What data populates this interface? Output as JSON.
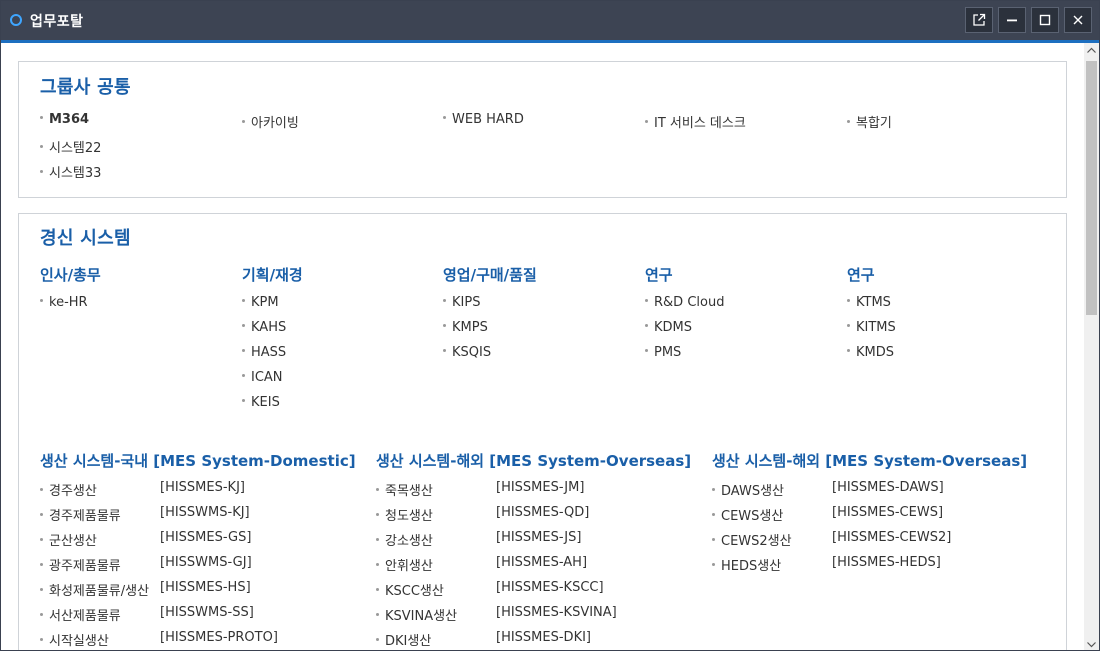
{
  "window": {
    "title": "업무포탈",
    "accent_color": "#1d6fc0",
    "titlebar_color": "#3d4453",
    "buttons": [
      "popout-icon",
      "minimize-icon",
      "maximize-icon",
      "close-icon"
    ]
  },
  "common": {
    "title": "그룹사 공통",
    "columns": [
      [
        "M364",
        "시스템22",
        "시스템33"
      ],
      [
        "아카이빙"
      ],
      [
        "WEB HARD"
      ],
      [
        "IT 서비스 데스크"
      ],
      [
        "복합기"
      ]
    ]
  },
  "mgmt": {
    "title": "경신 시스템",
    "groups": [
      {
        "heading": "인사/총무",
        "items": [
          "ke-HR"
        ]
      },
      {
        "heading": "기획/재경",
        "items": [
          "KPM",
          "KAHS",
          "HASS",
          "ICAN",
          "KEIS"
        ]
      },
      {
        "heading": "영업/구매/품질",
        "items": [
          "KIPS",
          "KMPS",
          "KSQIS"
        ]
      },
      {
        "heading": "연구",
        "items": [
          "R&D Cloud",
          "KDMS",
          "PMS"
        ]
      },
      {
        "heading": "연구",
        "items": [
          "KTMS",
          "KITMS",
          "KMDS"
        ]
      }
    ]
  },
  "mes": [
    {
      "heading": "생산 시스템-국내 [MES System-Domestic]",
      "rows": [
        {
          "name": "경주생산",
          "code": "[HISSMES-KJ]"
        },
        {
          "name": "경주제품물류",
          "code": "[HISSWMS-KJ]"
        },
        {
          "name": "군산생산",
          "code": "[HISSMES-GS]"
        },
        {
          "name": "광주제품물류",
          "code": "[HISSWMS-GJ]"
        },
        {
          "name": "화성제품물류/생산",
          "code": "[HISSMES-HS]"
        },
        {
          "name": "서산제품물류",
          "code": "[HISSWMS-SS]"
        },
        {
          "name": "시작실생산",
          "code": "[HISSMES-PROTO]"
        }
      ]
    },
    {
      "heading": "생산 시스템-해외 [MES System-Overseas]",
      "rows": [
        {
          "name": "죽목생산",
          "code": "[HISSMES-JM]"
        },
        {
          "name": "청도생산",
          "code": "[HISSMES-QD]"
        },
        {
          "name": "강소생산",
          "code": "[HISSMES-JS]"
        },
        {
          "name": "안휘생산",
          "code": "[HISSMES-AH]"
        },
        {
          "name": "KSCC생산",
          "code": "[HISSMES-KSCC]"
        },
        {
          "name": "KSVINA생산",
          "code": "[HISSMES-KSVINA]"
        },
        {
          "name": "DKI생산",
          "code": "[HISSMES-DKI]"
        }
      ]
    },
    {
      "heading": "생산 시스템-해외 [MES System-Overseas]",
      "rows": [
        {
          "name": "DAWS생산",
          "code": "[HISSMES-DAWS]"
        },
        {
          "name": "CEWS생산",
          "code": "[HISSMES-CEWS]"
        },
        {
          "name": "CEWS2생산",
          "code": "[HISSMES-CEWS2]"
        },
        {
          "name": "HEDS생산",
          "code": "[HISSMES-HEDS]"
        }
      ]
    }
  ]
}
